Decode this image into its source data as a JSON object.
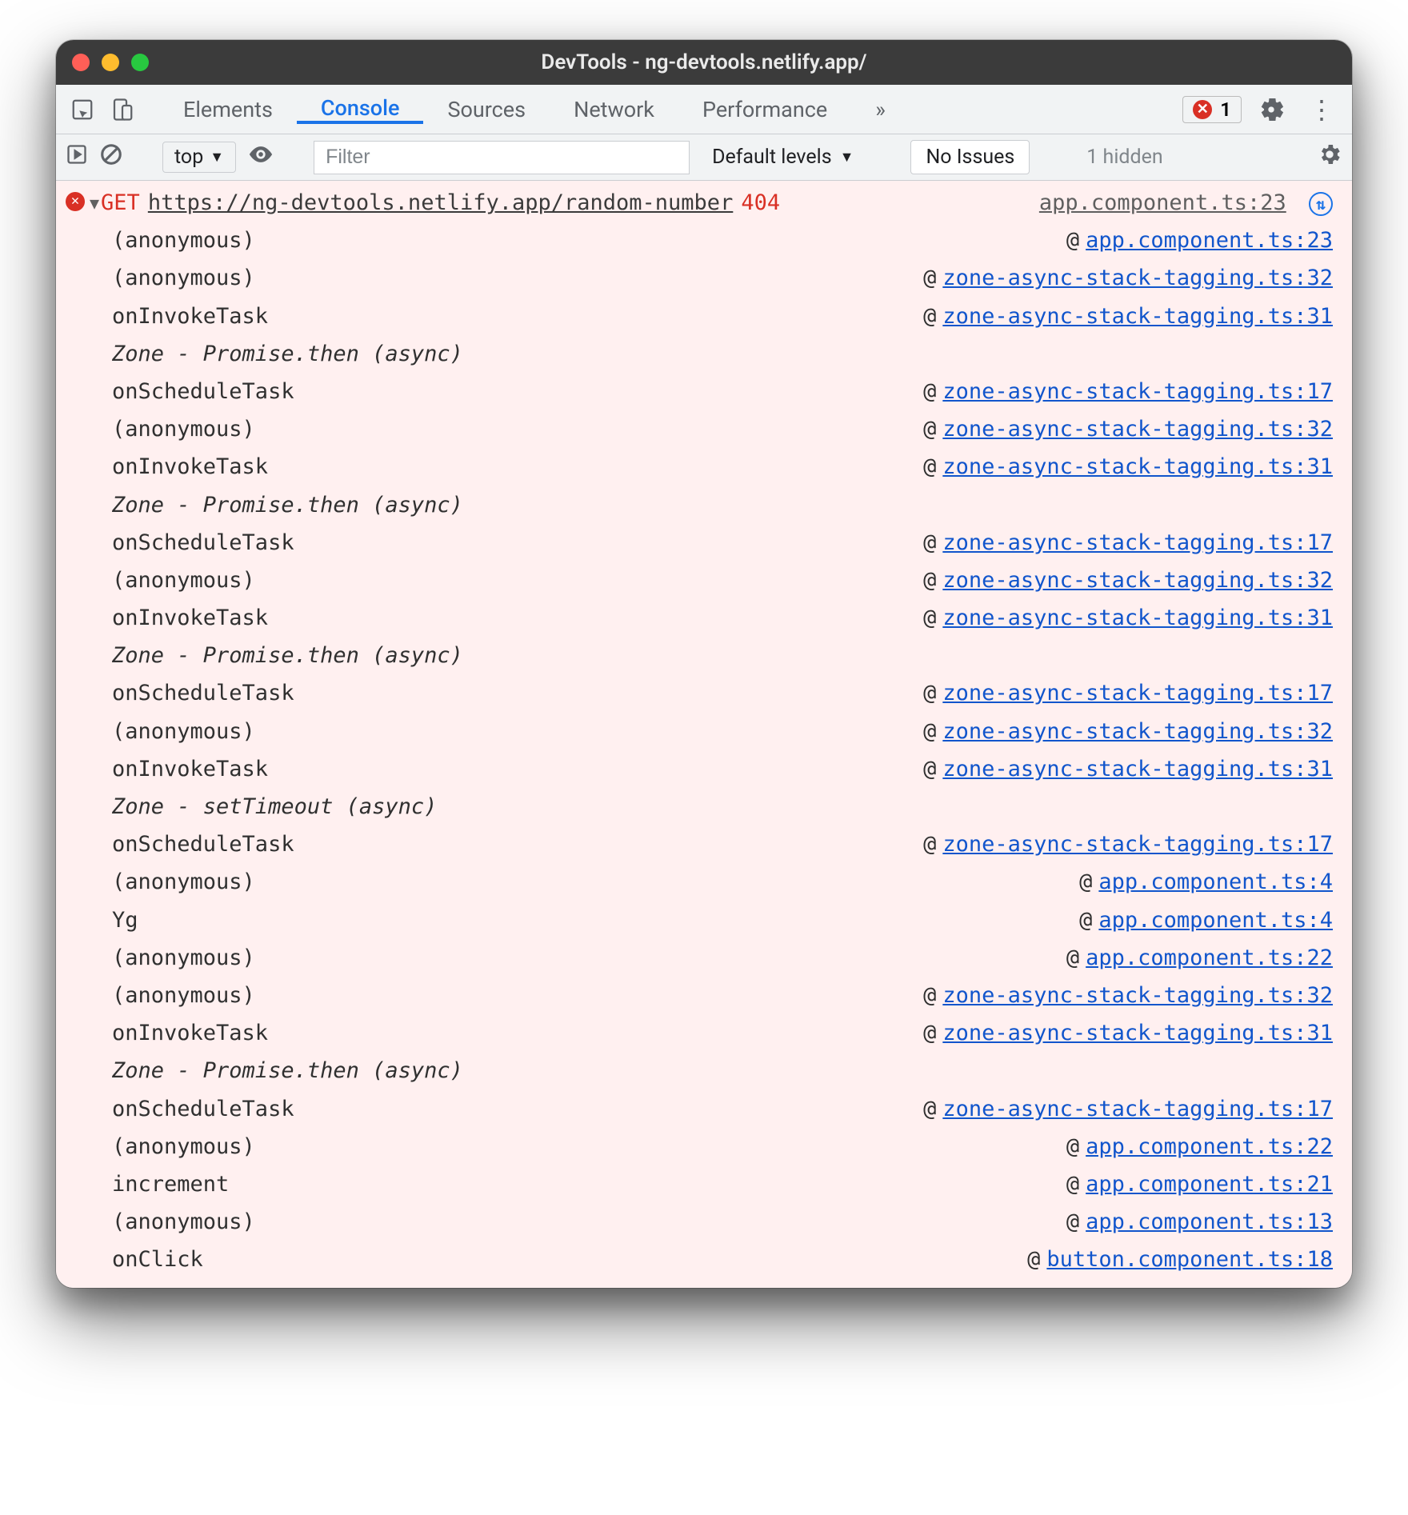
{
  "window_title": "DevTools - ng-devtools.netlify.app/",
  "tabs": [
    "Elements",
    "Console",
    "Sources",
    "Network",
    "Performance"
  ],
  "active_tab": "Console",
  "overflow_glyph": "»",
  "error_count": "1",
  "filterbar": {
    "context": "top",
    "filter_placeholder": "Filter",
    "levels": "Default levels",
    "no_issues": "No Issues",
    "hidden": "1 hidden"
  },
  "error": {
    "method": "GET",
    "url": "https://ng-devtools.netlify.app/random-number",
    "status": "404",
    "source": "app.component.ts:23",
    "reload_glyph": "⇅"
  },
  "stack": [
    {
      "type": "frame",
      "fn": "(anonymous)",
      "src": "app.component.ts:23"
    },
    {
      "type": "frame",
      "fn": "(anonymous)",
      "src": "zone-async-stack-tagging.ts:32"
    },
    {
      "type": "frame",
      "fn": "onInvokeTask",
      "src": "zone-async-stack-tagging.ts:31"
    },
    {
      "type": "zone",
      "label": "Zone - Promise.then (async)"
    },
    {
      "type": "frame",
      "fn": "onScheduleTask",
      "src": "zone-async-stack-tagging.ts:17"
    },
    {
      "type": "frame",
      "fn": "(anonymous)",
      "src": "zone-async-stack-tagging.ts:32"
    },
    {
      "type": "frame",
      "fn": "onInvokeTask",
      "src": "zone-async-stack-tagging.ts:31"
    },
    {
      "type": "zone",
      "label": "Zone - Promise.then (async)"
    },
    {
      "type": "frame",
      "fn": "onScheduleTask",
      "src": "zone-async-stack-tagging.ts:17"
    },
    {
      "type": "frame",
      "fn": "(anonymous)",
      "src": "zone-async-stack-tagging.ts:32"
    },
    {
      "type": "frame",
      "fn": "onInvokeTask",
      "src": "zone-async-stack-tagging.ts:31"
    },
    {
      "type": "zone",
      "label": "Zone - Promise.then (async)"
    },
    {
      "type": "frame",
      "fn": "onScheduleTask",
      "src": "zone-async-stack-tagging.ts:17"
    },
    {
      "type": "frame",
      "fn": "(anonymous)",
      "src": "zone-async-stack-tagging.ts:32"
    },
    {
      "type": "frame",
      "fn": "onInvokeTask",
      "src": "zone-async-stack-tagging.ts:31"
    },
    {
      "type": "zone",
      "label": "Zone - setTimeout (async)"
    },
    {
      "type": "frame",
      "fn": "onScheduleTask",
      "src": "zone-async-stack-tagging.ts:17"
    },
    {
      "type": "frame",
      "fn": "(anonymous)",
      "src": "app.component.ts:4"
    },
    {
      "type": "frame",
      "fn": "Yg",
      "src": "app.component.ts:4"
    },
    {
      "type": "frame",
      "fn": "(anonymous)",
      "src": "app.component.ts:22"
    },
    {
      "type": "frame",
      "fn": "(anonymous)",
      "src": "zone-async-stack-tagging.ts:32"
    },
    {
      "type": "frame",
      "fn": "onInvokeTask",
      "src": "zone-async-stack-tagging.ts:31"
    },
    {
      "type": "zone",
      "label": "Zone - Promise.then (async)"
    },
    {
      "type": "frame",
      "fn": "onScheduleTask",
      "src": "zone-async-stack-tagging.ts:17"
    },
    {
      "type": "frame",
      "fn": "(anonymous)",
      "src": "app.component.ts:22"
    },
    {
      "type": "frame",
      "fn": "increment",
      "src": "app.component.ts:21"
    },
    {
      "type": "frame",
      "fn": "(anonymous)",
      "src": "app.component.ts:13"
    },
    {
      "type": "frame",
      "fn": "onClick",
      "src": "button.component.ts:18"
    }
  ]
}
